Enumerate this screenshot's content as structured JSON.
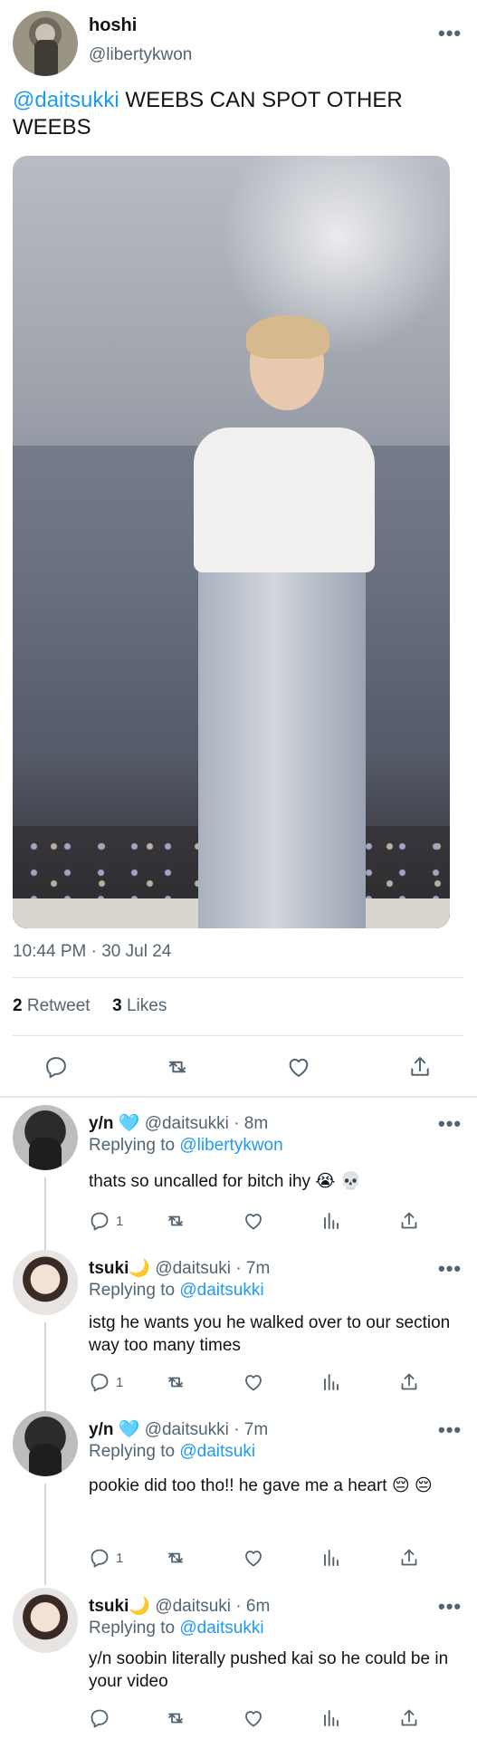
{
  "main_tweet": {
    "name": "hoshi",
    "handle": "@libertykwon",
    "mention": "@daitsukki",
    "text": " WEEBS CAN SPOT OTHER WEEBS",
    "time": "10:44 PM · 30 Jul 24",
    "retweets_count": "2",
    "retweets_label": "Retweet",
    "likes_count": "3",
    "likes_label": "Likes",
    "more": "•••"
  },
  "replies": [
    {
      "name": "y/n",
      "emoji": "🩵",
      "handle": "@daitsukki",
      "time": "· 8m",
      "replying_label": "Replying to ",
      "replying_to": "@libertykwon",
      "text": "thats so uncalled for bitch ihy 😭 💀",
      "reply_count": "1",
      "more": "•••"
    },
    {
      "name": "tsuki",
      "emoji": "🌙",
      "handle": "@daitsuki",
      "time": "· 7m",
      "replying_label": "Replying to ",
      "replying_to": "@daitsukki",
      "text": "istg he wants you he walked over to our section way too many times",
      "reply_count": "1",
      "more": "•••"
    },
    {
      "name": "y/n",
      "emoji": "🩵",
      "handle": "@daitsukki",
      "time": "· 7m",
      "replying_label": "Replying to ",
      "replying_to": "@daitsuki",
      "text": "pookie did too tho!! he gave me a heart 😔 😔",
      "reply_count": "1",
      "more": "•••"
    },
    {
      "name": "tsuki",
      "emoji": "🌙",
      "handle": "@daitsuki",
      "time": "· 6m",
      "replying_label": "Replying to ",
      "replying_to": "@daitsukki",
      "text": "y/n soobin literally pushed kai so he could be in your video",
      "reply_count": "",
      "more": "•••"
    }
  ],
  "icons": [
    "reply-icon",
    "retweet-icon",
    "like-icon",
    "views-icon",
    "share-icon",
    "more-icon"
  ],
  "colors": {
    "accent": "#1d9bf0",
    "secondary_text": "#536471",
    "primary_text": "#0f1419"
  }
}
